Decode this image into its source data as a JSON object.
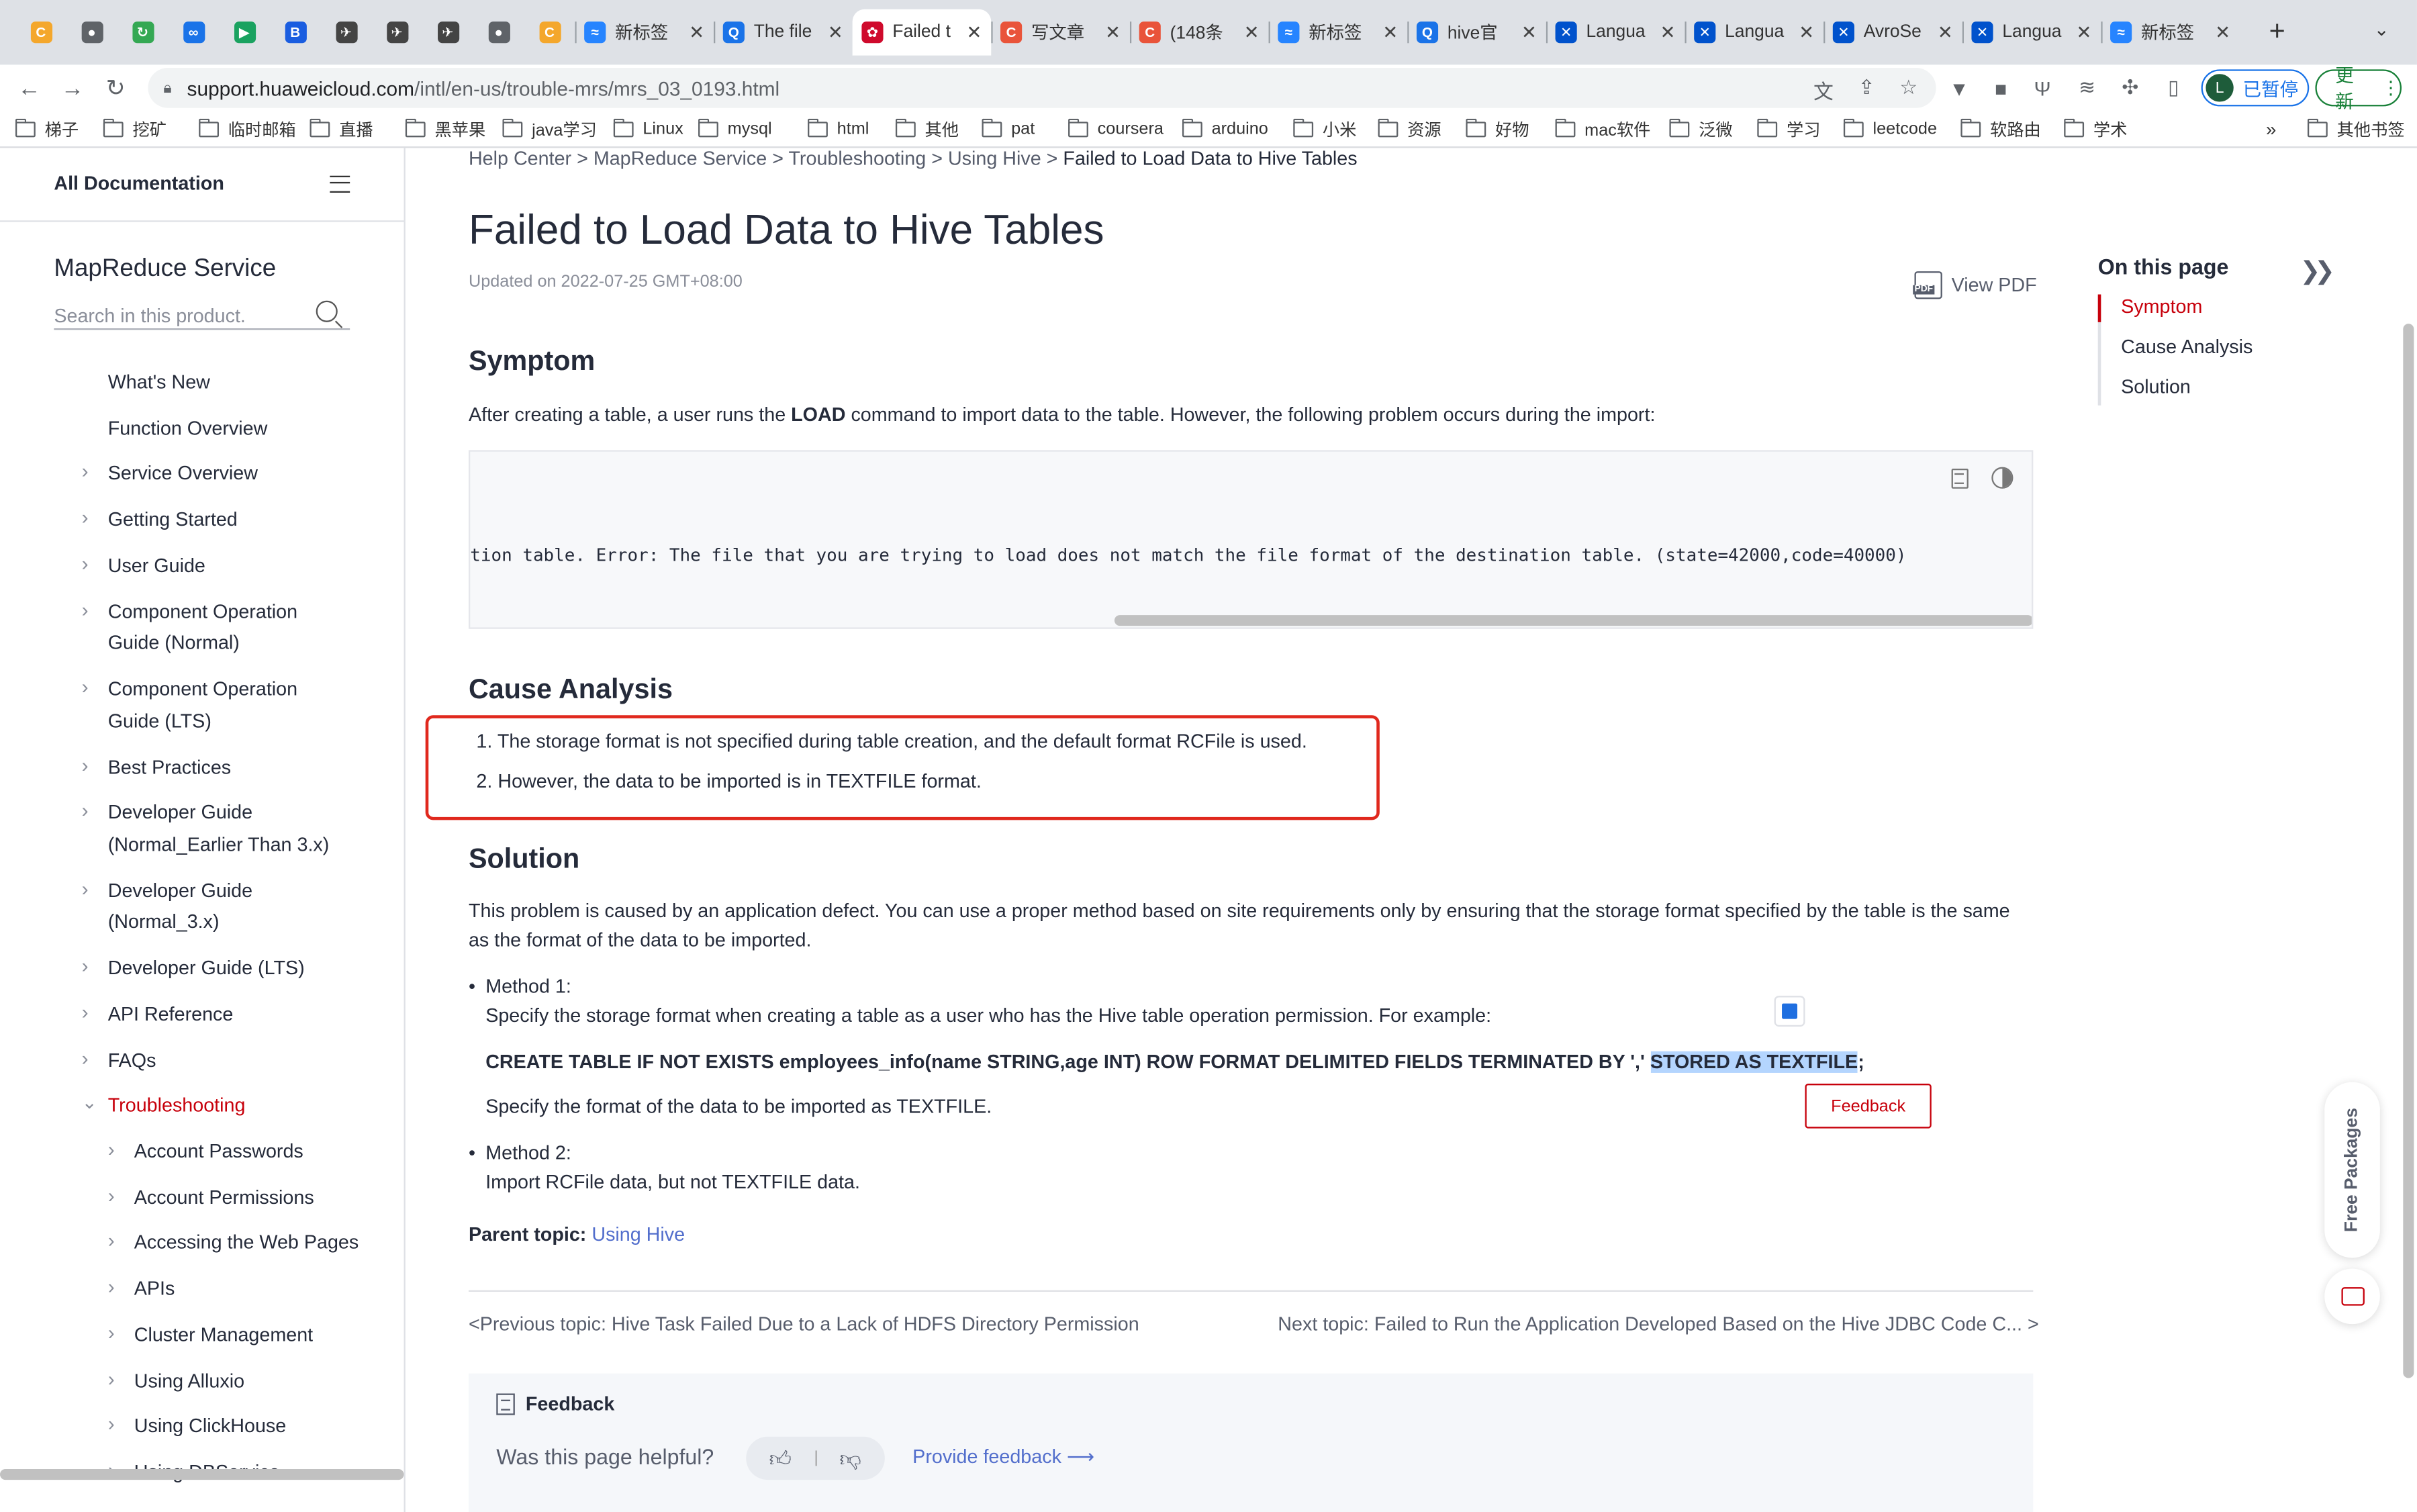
{
  "browser": {
    "tabs": [
      {
        "kind": "pinned",
        "icon": "csdn-c-icon",
        "color": "#f4a72c",
        "glyph": "C",
        "title": ""
      },
      {
        "kind": "pinned",
        "icon": "globe-icon",
        "color": "#5f6368",
        "glyph": "●",
        "title": ""
      },
      {
        "kind": "pinned",
        "icon": "recycle-icon",
        "color": "#34a853",
        "glyph": "↻",
        "title": ""
      },
      {
        "kind": "pinned",
        "icon": "link-icon",
        "color": "#1a73e8",
        "glyph": "∞",
        "title": ""
      },
      {
        "kind": "pinned",
        "icon": "play-icon",
        "color": "#1aa260",
        "glyph": "▶",
        "title": ""
      },
      {
        "kind": "pinned",
        "icon": "translate-icon",
        "color": "#1a5de0",
        "glyph": "B",
        "title": ""
      },
      {
        "kind": "pinned",
        "icon": "paper-plane-icon",
        "color": "#444",
        "glyph": "✈",
        "title": ""
      },
      {
        "kind": "pinned",
        "icon": "paper-plane-icon",
        "color": "#444",
        "glyph": "✈",
        "title": ""
      },
      {
        "kind": "pinned",
        "icon": "paper-plane-icon",
        "color": "#444",
        "glyph": "✈",
        "title": ""
      },
      {
        "kind": "pinned",
        "icon": "globe-icon",
        "color": "#5f6368",
        "glyph": "●",
        "title": ""
      },
      {
        "kind": "pinned",
        "icon": "csdn-c-icon",
        "color": "#f4a72c",
        "glyph": "C",
        "title": ""
      },
      {
        "kind": "normal",
        "icon": "confluence-icon",
        "color": "#2684ff",
        "glyph": "≈",
        "title": "新标签"
      },
      {
        "kind": "normal",
        "icon": "search-icon",
        "color": "#1a73e8",
        "glyph": "Q",
        "title": "The file"
      },
      {
        "kind": "active",
        "icon": "huawei-icon",
        "color": "#cf0a2c",
        "glyph": "✿",
        "title": "Failed t"
      },
      {
        "kind": "normal",
        "icon": "csdn-c-icon",
        "color": "#e9543a",
        "glyph": "C",
        "title": "写文章"
      },
      {
        "kind": "normal",
        "icon": "csdn-c-icon",
        "color": "#e9543a",
        "glyph": "C",
        "title": "(148条"
      },
      {
        "kind": "normal",
        "icon": "confluence-icon",
        "color": "#2684ff",
        "glyph": "≈",
        "title": "新标签"
      },
      {
        "kind": "normal",
        "icon": "search-icon",
        "color": "#1a73e8",
        "glyph": "Q",
        "title": "hive官"
      },
      {
        "kind": "normal",
        "icon": "confluence-x-icon",
        "color": "#0052cc",
        "glyph": "✕",
        "title": "Langua"
      },
      {
        "kind": "normal",
        "icon": "confluence-x-icon",
        "color": "#0052cc",
        "glyph": "✕",
        "title": "Langua"
      },
      {
        "kind": "normal",
        "icon": "confluence-x-icon",
        "color": "#0052cc",
        "glyph": "✕",
        "title": "AvroSe"
      },
      {
        "kind": "normal",
        "icon": "confluence-x-icon",
        "color": "#0052cc",
        "glyph": "✕",
        "title": "Langua"
      },
      {
        "kind": "normal",
        "icon": "confluence-icon",
        "color": "#2684ff",
        "glyph": "≈",
        "title": "新标签"
      }
    ],
    "url_host": "support.huaweicloud.com",
    "url_path": "/intl/en-us/trouble-mrs/mrs_03_0193.html",
    "profile_initial": "L",
    "profile_label": "已暂停",
    "update_label": "更新",
    "bookmarks": [
      "梯子",
      "挖矿",
      "临时邮箱",
      "直播",
      "黑苹果",
      "java学习",
      "Linux",
      "mysql",
      "html",
      "其他",
      "pat",
      "coursera",
      "arduino",
      "小米",
      "资源",
      "好物",
      "mac软件",
      "泛微",
      "学习",
      "leetcode",
      "软路由",
      "学术"
    ],
    "other_bookmarks": "其他书签"
  },
  "sidebar": {
    "header": "All Documentation",
    "product": "MapReduce Service",
    "search_placeholder": "Search in this product.",
    "items": [
      {
        "label": "What's New",
        "level": 0,
        "chev": false,
        "lines": 1
      },
      {
        "label": "Function Overview",
        "level": 0,
        "chev": false,
        "lines": 1
      },
      {
        "label": "Service Overview",
        "level": 0,
        "chev": true,
        "lines": 1
      },
      {
        "label": "Getting Started",
        "level": 0,
        "chev": true,
        "lines": 1
      },
      {
        "label": "User Guide",
        "level": 0,
        "chev": true,
        "lines": 1
      },
      {
        "label": "Component Operation\nGuide (Normal)",
        "level": 0,
        "chev": true,
        "lines": 2
      },
      {
        "label": "Component Operation\nGuide (LTS)",
        "level": 0,
        "chev": true,
        "lines": 2
      },
      {
        "label": "Best Practices",
        "level": 0,
        "chev": true,
        "lines": 1
      },
      {
        "label": "Developer Guide\n(Normal_Earlier Than 3.x)",
        "level": 0,
        "chev": true,
        "lines": 2
      },
      {
        "label": "Developer Guide\n(Normal_3.x)",
        "level": 0,
        "chev": true,
        "lines": 2
      },
      {
        "label": "Developer Guide (LTS)",
        "level": 0,
        "chev": true,
        "lines": 1
      },
      {
        "label": "API Reference",
        "level": 0,
        "chev": true,
        "lines": 1
      },
      {
        "label": "FAQs",
        "level": 0,
        "chev": true,
        "lines": 1
      },
      {
        "label": "Troubleshooting",
        "level": 0,
        "chev": true,
        "lines": 1,
        "active": true,
        "open": true
      },
      {
        "label": "Account Passwords",
        "level": 1,
        "chev": true,
        "lines": 1
      },
      {
        "label": "Account Permissions",
        "level": 1,
        "chev": true,
        "lines": 1
      },
      {
        "label": "Accessing the Web Pages",
        "level": 1,
        "chev": true,
        "lines": 1
      },
      {
        "label": "APIs",
        "level": 1,
        "chev": true,
        "lines": 1
      },
      {
        "label": "Cluster Management",
        "level": 1,
        "chev": true,
        "lines": 1
      },
      {
        "label": "Using Alluxio",
        "level": 1,
        "chev": true,
        "lines": 1
      },
      {
        "label": "Using ClickHouse",
        "level": 1,
        "chev": true,
        "lines": 1
      },
      {
        "label": "Using DBService",
        "level": 1,
        "chev": true,
        "lines": 1
      }
    ]
  },
  "content": {
    "breadcrumb": [
      "Help Center",
      "MapReduce Service",
      "Troubleshooting",
      "Using Hive",
      "Failed to Load Data to Hive Tables"
    ],
    "title": "Failed to Load Data to Hive Tables",
    "updated": "Updated on 2022-07-25 GMT+08:00",
    "view_pdf": "View PDF",
    "symptom_heading": "Symptom",
    "symptom_pre": "After creating a table, a user runs the ",
    "symptom_bold": "LOAD",
    "symptom_post": " command to import data to the table. However, the following problem occurs during the import:",
    "code_line": "tion table. Error: The file that you are trying to load does not match the file format of the destination table. (state=42000,code=40000)",
    "cause_heading": "Cause Analysis",
    "cause_items": [
      "1. The storage format is not specified during table creation, and the default format RCFile is used.",
      "2. However, the data to be imported is in TEXTFILE format."
    ],
    "solution_heading": "Solution",
    "solution_para_1": "This problem is caused by an application defect. You can use a proper method based on site requirements only by ensuring that the storage format specified by the table is the same",
    "solution_para_2": "as the format of the data to be imported.",
    "method1_label": "Method 1:",
    "method1_text": "Specify the storage format when creating a table as a user who has the Hive table operation permission. For example:",
    "method1_sql_pre": "CREATE TABLE IF NOT EXISTS employees_info(name STRING,age INT) ROW FORMAT DELIMITED FIELDS TERMINATED BY ',' ",
    "method1_sql_sel": "STORED AS TEXTFILE",
    "method1_sql_post": ";",
    "method1_after": "Specify the format of the data to be imported as TEXTFILE.",
    "feedback_button": "Feedback",
    "method2_label": "Method 2:",
    "method2_text": "Import RCFile data, but not TEXTFILE data.",
    "parent_label": "Parent topic: ",
    "parent_link": "Using Hive",
    "prev_topic": "<Previous topic: Hive Task Failed Due to a Lack of HDFS Directory Permission",
    "next_topic": "Next topic: Failed to Run the Application Developed Based on the Hive JDBC Code C...  >",
    "feedback_title": "Feedback",
    "feedback_question": "Was this page helpful?",
    "provide_feedback": "Provide feedback",
    "provide_arrow": "⟶"
  },
  "toc": {
    "title": "On this page",
    "items": [
      "Symptom",
      "Cause Analysis",
      "Solution"
    ]
  },
  "widgets": {
    "free_packages": "Free Packages"
  }
}
